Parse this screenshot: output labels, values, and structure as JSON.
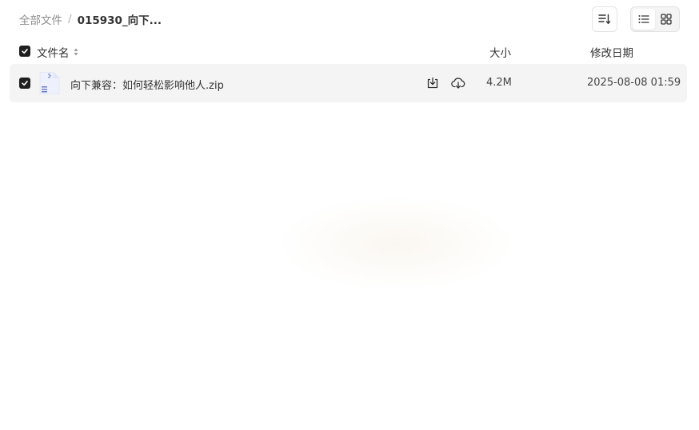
{
  "breadcrumb": {
    "root": "全部文件",
    "separator": "/",
    "current": "015930_向下..."
  },
  "toolbar": {
    "sort_icon": "sort-lines-icon",
    "view_list_icon": "list-view-icon",
    "view_grid_icon": "grid-view-icon",
    "active_view": "list"
  },
  "table": {
    "columns": {
      "name": "文件名",
      "size": "大小",
      "date": "修改日期"
    },
    "rows": [
      {
        "checked": true,
        "icon": "zip-file-icon",
        "name": "向下兼容：如何轻松影响他人.zip",
        "size": "4.2M",
        "date": "2025-08-08 01:59"
      }
    ]
  },
  "colors": {
    "accent": "#1f1f1f",
    "row_selected_bg": "#f4f4f5",
    "muted_text": "#8c8c8c"
  }
}
